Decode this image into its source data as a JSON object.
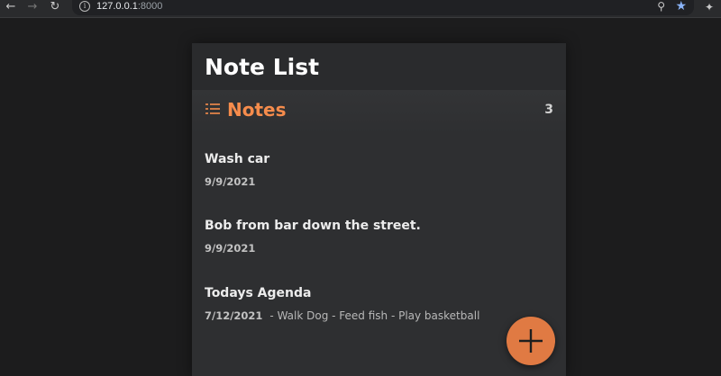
{
  "browser": {
    "url_host": "127.0.0.1",
    "url_port": ":8000",
    "icons": {
      "back": "back-arrow-icon",
      "forward": "forward-arrow-icon",
      "reload": "reload-icon",
      "site_info": "info-icon",
      "zoom": "zoom-icon",
      "bookmark": "star-icon",
      "extensions": "puzzle-icon"
    },
    "bookmark_color": "#8ab4f8"
  },
  "app": {
    "title": "Note List",
    "notes_label": "Notes",
    "notes_count": "3",
    "accent_color": "#f68c4c",
    "fab_color": "#e07a43",
    "notes": [
      {
        "title": "Wash car",
        "date": "9/9/2021",
        "preview": ""
      },
      {
        "title": "Bob from bar down the street.",
        "date": "9/9/2021",
        "preview": ""
      },
      {
        "title": "Todays Agenda",
        "date": "7/12/2021",
        "preview": "- Walk Dog - Feed fish - Play basketball"
      }
    ]
  }
}
